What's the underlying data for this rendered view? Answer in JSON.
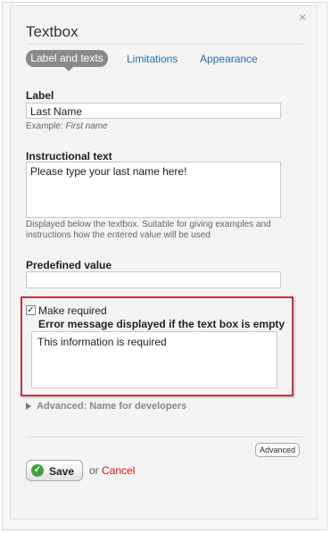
{
  "dialog": {
    "title": "Textbox",
    "close_glyph": "×"
  },
  "tabs": [
    {
      "label": "Label and texts",
      "active": true
    },
    {
      "label": "Limitations",
      "active": false
    },
    {
      "label": "Appearance",
      "active": false
    }
  ],
  "label_field": {
    "heading": "Label",
    "value": "Last Name",
    "example_prefix": "Example:",
    "example_value": "First name"
  },
  "instructional_field": {
    "heading": "Instructional text",
    "value": "Please type your last name here!",
    "hint": "Displayed below the textbox. Suitable for giving examples and instructions how the entered value will be used"
  },
  "predefined_field": {
    "heading": "Predefined value",
    "value": ""
  },
  "required": {
    "checked": true,
    "label": "Make required",
    "error_heading": "Error message displayed if the text box is empty",
    "error_value": "This information is required"
  },
  "advanced_section": {
    "label": "Advanced: Name for developers"
  },
  "footer": {
    "advanced_button": "Advanced",
    "save_label": "Save",
    "or_text": "or",
    "cancel_label": "Cancel"
  },
  "colors": {
    "accent_link": "#2a6fb0",
    "highlight_border": "#c0393b",
    "cancel": "#dd1111",
    "save_icon": "#3fa33f"
  }
}
